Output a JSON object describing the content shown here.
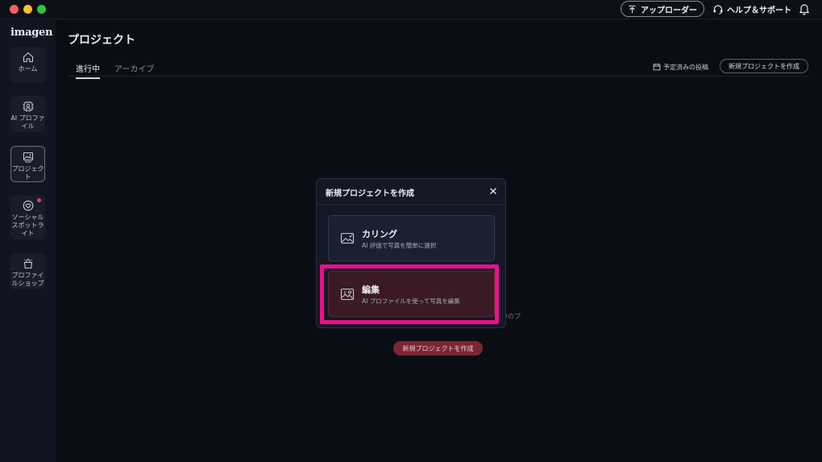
{
  "titlebar": {
    "uploader_label": "アップローダー",
    "help_label": "ヘルプ＆サポート"
  },
  "sidebar": {
    "logo": "imagen",
    "items": [
      {
        "label": "ホーム",
        "icon": "home-icon"
      },
      {
        "label": "AI プロファイル",
        "icon": "ai-profile-icon"
      },
      {
        "label": "プロジェクト",
        "icon": "project-icon",
        "active": true
      },
      {
        "label": "ソーシャルスポットライト",
        "icon": "social-spotlight-icon",
        "notification_dot": true
      },
      {
        "label": "プロファイルショップ",
        "icon": "profile-shop-icon"
      }
    ]
  },
  "main": {
    "title": "プロジェクト",
    "tabs": [
      {
        "label": "進行中",
        "active": true
      },
      {
        "label": "アーカイブ",
        "active": false
      }
    ],
    "scheduled_posts_label": "予定済みの投稿",
    "new_project_label": "新規プロジェクトを作成",
    "background_hint": "中のプ",
    "center_new_project_label": "新規プロジェクトを作成"
  },
  "modal": {
    "title": "新規プロジェクトを作成",
    "options": [
      {
        "title": "カリング",
        "description": "AI 評価で写真を簡単に選択",
        "icon": "culling-image-icon"
      },
      {
        "title": "編集",
        "description": "AI プロファイルを使って写真を編集",
        "icon": "edit-image-icon"
      }
    ]
  },
  "colors": {
    "highlight": "#ec0f8c",
    "accent_red": "#7b2633",
    "notification": "#e0455a"
  }
}
